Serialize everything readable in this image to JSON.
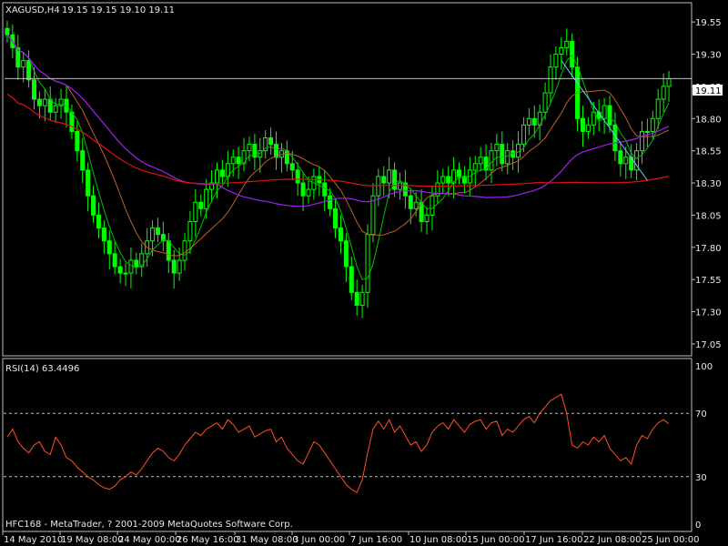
{
  "header": {
    "symbol": "XAGUSD,H4",
    "ohlc": "19.15 19.15 19.10 19.11",
    "current_price": "19.11"
  },
  "rsi_panel": {
    "label": "RSI(14) 63.4496",
    "levels": [
      "100",
      "70",
      "30",
      "0"
    ]
  },
  "footer": {
    "copyright": "HFC168 - MetaTrader, ? 2001-2009 MetaQuotes Software Corp."
  },
  "colors": {
    "background": "#000000",
    "candle": "#00ff00",
    "ma_fast": "#00c000",
    "ma_mid": "#c0602a",
    "ma_slow_purple": "#a020f0",
    "ma_long_red": "#e01010",
    "trendline": "#66ccff",
    "rsi": "#ff5020",
    "grid_frame": "#c0c0c0"
  },
  "chart_data": [
    {
      "type": "candlestick",
      "price_ticks": [
        "19.55",
        "19.30",
        "19.05",
        "18.80",
        "18.55",
        "18.30",
        "18.05",
        "17.80",
        "17.55",
        "17.30",
        "17.05"
      ],
      "time_labels": [
        "14 May 2010",
        "19 May 08:00",
        "24 May 00:00",
        "26 May 16:00",
        "31 May 08:00",
        "3 Jun 00:00",
        "7 Jun 16:00",
        "10 Jun 08:00",
        "15 Jun 00:00",
        "17 Jun 16:00",
        "22 Jun 08:00",
        "25 Jun 00:00"
      ],
      "ylim": [
        17.0,
        19.65
      ],
      "close": [
        19.45,
        19.35,
        19.2,
        19.25,
        19.1,
        18.95,
        18.9,
        18.95,
        18.85,
        18.9,
        18.95,
        18.85,
        18.7,
        18.55,
        18.4,
        18.2,
        18.05,
        17.95,
        17.85,
        17.75,
        17.65,
        17.6,
        17.6,
        17.7,
        17.65,
        17.75,
        17.85,
        17.95,
        17.9,
        17.85,
        17.7,
        17.6,
        17.7,
        17.85,
        18.0,
        18.15,
        18.1,
        18.25,
        18.3,
        18.4,
        18.35,
        18.45,
        18.5,
        18.45,
        18.55,
        18.6,
        18.5,
        18.55,
        18.65,
        18.6,
        18.5,
        18.55,
        18.45,
        18.4,
        18.3,
        18.2,
        18.25,
        18.35,
        18.3,
        18.2,
        18.1,
        17.95,
        17.85,
        17.65,
        17.45,
        17.35,
        17.45,
        17.9,
        18.2,
        18.35,
        18.3,
        18.4,
        18.25,
        18.3,
        18.2,
        18.1,
        18.15,
        18.0,
        18.05,
        18.2,
        18.3,
        18.35,
        18.3,
        18.4,
        18.35,
        18.3,
        18.4,
        18.45,
        18.5,
        18.4,
        18.55,
        18.6,
        18.45,
        18.55,
        18.5,
        18.6,
        18.75,
        18.8,
        18.75,
        18.85,
        19.0,
        19.2,
        19.3,
        19.35,
        19.4,
        19.2,
        18.8,
        18.7,
        18.75,
        18.85,
        18.8,
        18.9,
        18.75,
        18.55,
        18.45,
        18.5,
        18.4,
        18.55,
        18.7,
        18.7,
        18.8,
        18.95,
        19.05,
        19.11
      ],
      "ma_fast_approx_last": 18.85,
      "ma_mid_approx_last": 18.72,
      "ma_slow_purple_approx_last": 18.72,
      "ma_long_red_approx_last": 18.38,
      "trendline": {
        "from": 19.25,
        "to": 18.32
      }
    },
    {
      "type": "line",
      "name": "RSI(14)",
      "ylim": [
        0,
        100
      ],
      "reference_levels": [
        70,
        30
      ],
      "values": [
        55,
        60,
        52,
        48,
        45,
        50,
        52,
        46,
        44,
        55,
        50,
        42,
        40,
        36,
        33,
        30,
        28,
        25,
        23,
        22,
        24,
        28,
        30,
        33,
        31,
        35,
        40,
        45,
        48,
        46,
        42,
        40,
        44,
        50,
        54,
        58,
        56,
        60,
        62,
        64,
        60,
        66,
        63,
        58,
        60,
        62,
        55,
        57,
        59,
        60,
        52,
        55,
        48,
        44,
        40,
        38,
        45,
        52,
        50,
        45,
        40,
        35,
        30,
        25,
        22,
        20,
        28,
        45,
        60,
        65,
        60,
        66,
        58,
        62,
        56,
        50,
        52,
        46,
        50,
        58,
        62,
        64,
        60,
        66,
        62,
        58,
        63,
        65,
        66,
        60,
        64,
        65,
        56,
        60,
        58,
        62,
        66,
        68,
        64,
        70,
        74,
        78,
        80,
        82,
        70,
        50,
        48,
        52,
        50,
        55,
        52,
        56,
        48,
        44,
        40,
        42,
        38,
        50,
        56,
        54,
        60,
        64,
        66,
        63.45
      ]
    }
  ]
}
